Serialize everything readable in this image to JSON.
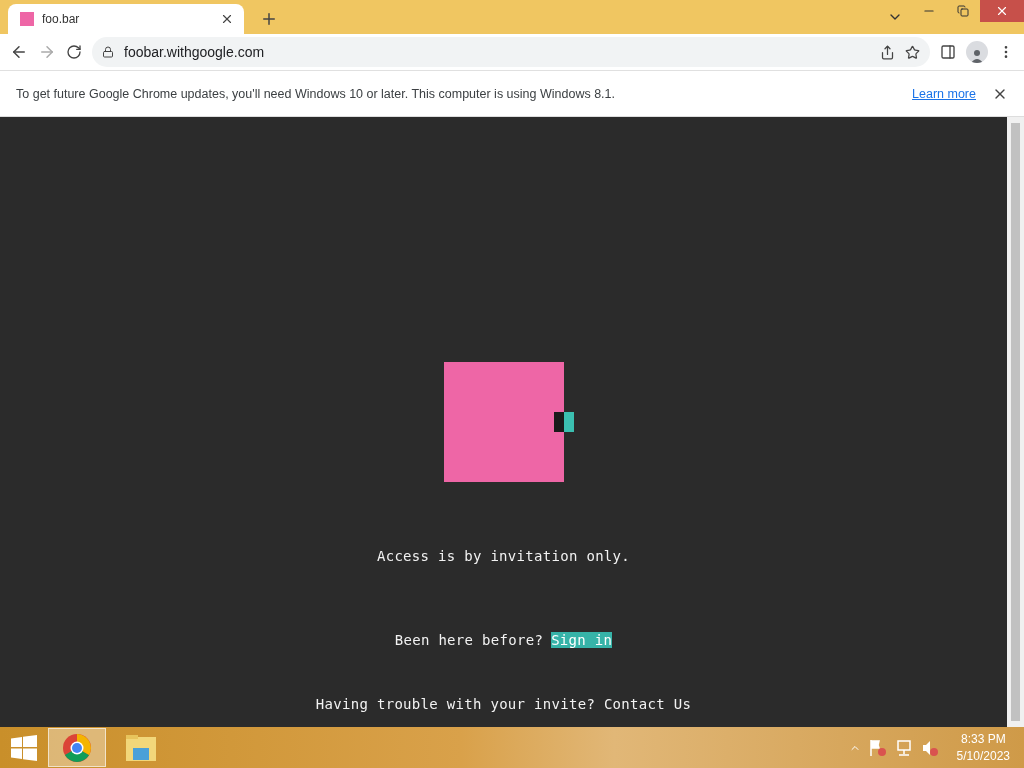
{
  "tab": {
    "title": "foo.bar",
    "selected": true
  },
  "address_bar": {
    "url": "foobar.withgoogle.com"
  },
  "infobar": {
    "message": "To get future Google Chrome updates, you'll need Windows 10 or later. This computer is using Windows 8.1.",
    "link": "Learn more"
  },
  "page": {
    "heading": "Access is by invitation only.",
    "prompt": "Been here before?",
    "sign_in": "Sign in",
    "help": "Having trouble with your invite? Contact Us"
  },
  "taskbar": {
    "apps": [
      {
        "kind": "chrome",
        "selected": true
      },
      {
        "kind": "explorer",
        "selected": false
      }
    ],
    "time": "8:33 PM",
    "date": "5/10/2023"
  }
}
